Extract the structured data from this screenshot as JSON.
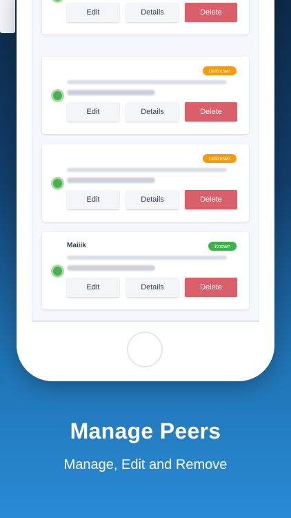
{
  "peers": [
    {
      "name": "",
      "badge": ""
    },
    {
      "name": "",
      "badge": "Unknown"
    },
    {
      "name": "",
      "badge": "Unknown"
    },
    {
      "name": "Maiiik",
      "badge": "Known"
    }
  ],
  "buttons": {
    "edit": "Edit",
    "details": "Details",
    "delete": "Delete"
  },
  "colors": {
    "delete": "#d9606a",
    "unknown_badge": "#f39c12",
    "known_badge": "#3cb34a",
    "online_dot": "#4caf50"
  },
  "promo": {
    "title": "Manage Peers",
    "subtitle": "Manage, Edit and Remove"
  }
}
